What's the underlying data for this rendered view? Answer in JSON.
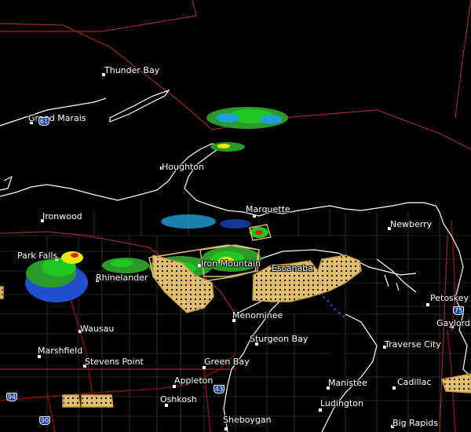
{
  "map": {
    "colors": {
      "background": "#000000",
      "shoreline": "#ffffff",
      "state_border": "#9a2a2a",
      "county_border": "#555555",
      "highway": "#7a1010",
      "warning_outline": "#c8a040",
      "warning_fill": "#e0c070",
      "radar_light": "#2a9a2a",
      "radar_med": "#1ec81e",
      "radar_heavy": "#e8e800",
      "radar_severe": "#e02020",
      "radar_blue": "#2050d0",
      "radar_cyan": "#20a0d8"
    },
    "cities": [
      {
        "name": "Thunder Bay"
      },
      {
        "name": "Grand Marais"
      },
      {
        "name": "Houghton"
      },
      {
        "name": "Ironwood"
      },
      {
        "name": "Marquette"
      },
      {
        "name": "Newberry"
      },
      {
        "name": "Park Falls"
      },
      {
        "name": "Rhinelander"
      },
      {
        "name": "Iron Mountain"
      },
      {
        "name": "Escanaba"
      },
      {
        "name": "Petoskey"
      },
      {
        "name": "Gaylord"
      },
      {
        "name": "Menominee"
      },
      {
        "name": "Wausau"
      },
      {
        "name": "Sturgeon Bay"
      },
      {
        "name": "Marshfield"
      },
      {
        "name": "Traverse City"
      },
      {
        "name": "Stevens Point"
      },
      {
        "name": "Green Bay"
      },
      {
        "name": "Appleton"
      },
      {
        "name": "Manistee"
      },
      {
        "name": "Cadillac"
      },
      {
        "name": "Oshkosh"
      },
      {
        "name": "Ludington"
      },
      {
        "name": "Sheboygan"
      },
      {
        "name": "Big Rapids"
      }
    ],
    "highway_shields": [
      {
        "label": "61"
      },
      {
        "label": "75"
      },
      {
        "label": "43"
      },
      {
        "label": "94"
      },
      {
        "label": "90"
      }
    ]
  }
}
